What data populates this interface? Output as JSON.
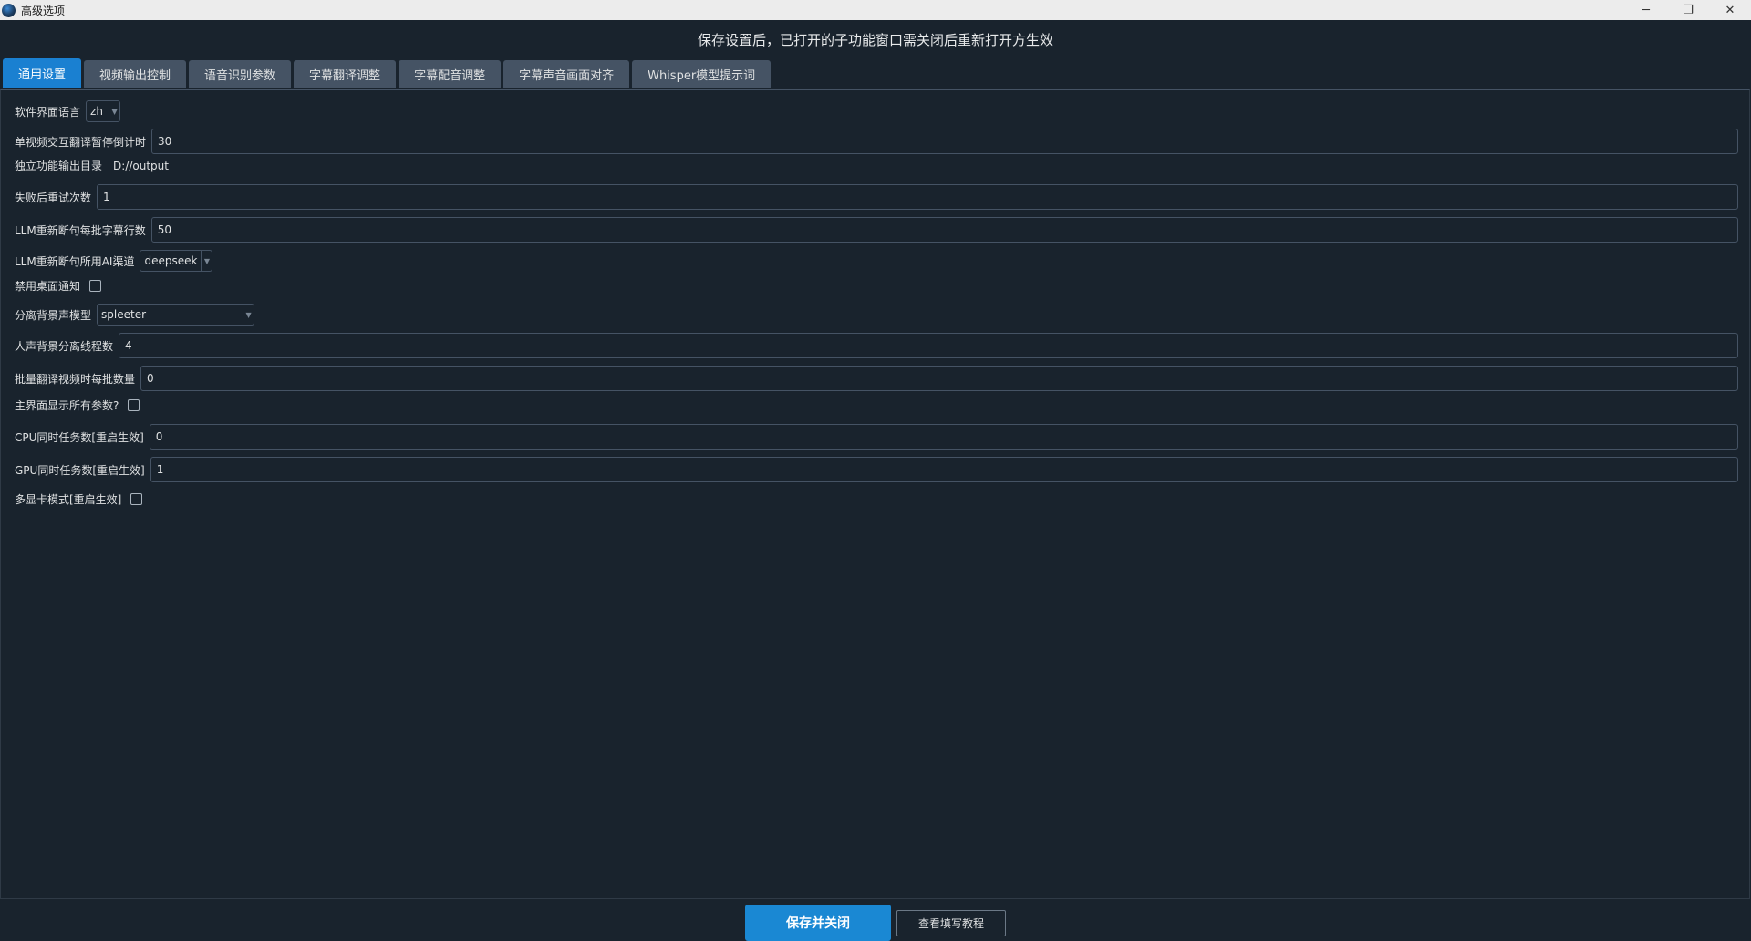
{
  "window": {
    "title": "高级选项",
    "controls": {
      "minimize": "─",
      "restore": "❐",
      "close": "✕"
    }
  },
  "notice": "保存设置后，已打开的子功能窗口需关闭后重新打开方生效",
  "tabs": [
    {
      "label": "通用设置",
      "active": true
    },
    {
      "label": "视频输出控制",
      "active": false
    },
    {
      "label": "语音识别参数",
      "active": false
    },
    {
      "label": "字幕翻译调整",
      "active": false
    },
    {
      "label": "字幕配音调整",
      "active": false
    },
    {
      "label": "字幕声音画面对齐",
      "active": false
    },
    {
      "label": "Whisper模型提示词",
      "active": false
    }
  ],
  "settings": {
    "ui_language": {
      "label": "软件界面语言",
      "value": "zh"
    },
    "countdown": {
      "label": "单视频交互翻译暂停倒计时",
      "value": "30"
    },
    "output_dir": {
      "label": "独立功能输出目录",
      "value": "D://output"
    },
    "retry": {
      "label": "失败后重试次数",
      "value": "1"
    },
    "llm_lines": {
      "label": "LLM重新断句每批字幕行数",
      "value": "50"
    },
    "llm_channel": {
      "label": "LLM重新断句所用AI渠道",
      "value": "deepseek"
    },
    "disable_notify": {
      "label": "禁用桌面通知",
      "checked": false
    },
    "sep_model": {
      "label": "分离背景声模型",
      "value": "spleeter"
    },
    "sep_threads": {
      "label": "人声背景分离线程数",
      "value": "4"
    },
    "batch_count": {
      "label": "批量翻译视频时每批数量",
      "value": "0"
    },
    "show_all": {
      "label": "主界面显示所有参数?",
      "checked": false
    },
    "cpu_tasks": {
      "label": "CPU同时任务数[重启生效]",
      "value": "0"
    },
    "gpu_tasks": {
      "label": "GPU同时任务数[重启生效]",
      "value": "1"
    },
    "multi_gpu": {
      "label": "多显卡模式[重启生效]",
      "checked": false
    }
  },
  "buttons": {
    "save": "保存并关闭",
    "tutorial": "查看填写教程"
  },
  "colors": {
    "background": "#19232d",
    "accent": "#1a88d3",
    "tab_inactive": "#455364"
  }
}
